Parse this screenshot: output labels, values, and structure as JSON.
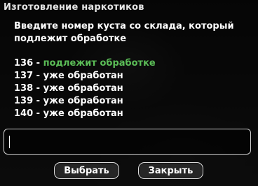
{
  "dialog": {
    "title": "Изготовление наркотиков",
    "prompt": "Введите номер куста со склада, который подлежит обработке",
    "items": [
      {
        "number": "136",
        "sep": " - ",
        "status": "подлежит обработке",
        "color": "#5bbd57"
      },
      {
        "number": "137",
        "sep": " - ",
        "status": "уже обработан",
        "color": "#ffffff"
      },
      {
        "number": "138",
        "sep": " - ",
        "status": "уже обработан",
        "color": "#ffffff"
      },
      {
        "number": "139",
        "sep": " - ",
        "status": "уже обработан",
        "color": "#ffffff"
      },
      {
        "number": "140",
        "sep": " - ",
        "status": "уже обработан",
        "color": "#ffffff"
      }
    ],
    "input": {
      "value": ""
    },
    "buttons": {
      "select": "Выбрать",
      "close": "Закрыть"
    }
  }
}
